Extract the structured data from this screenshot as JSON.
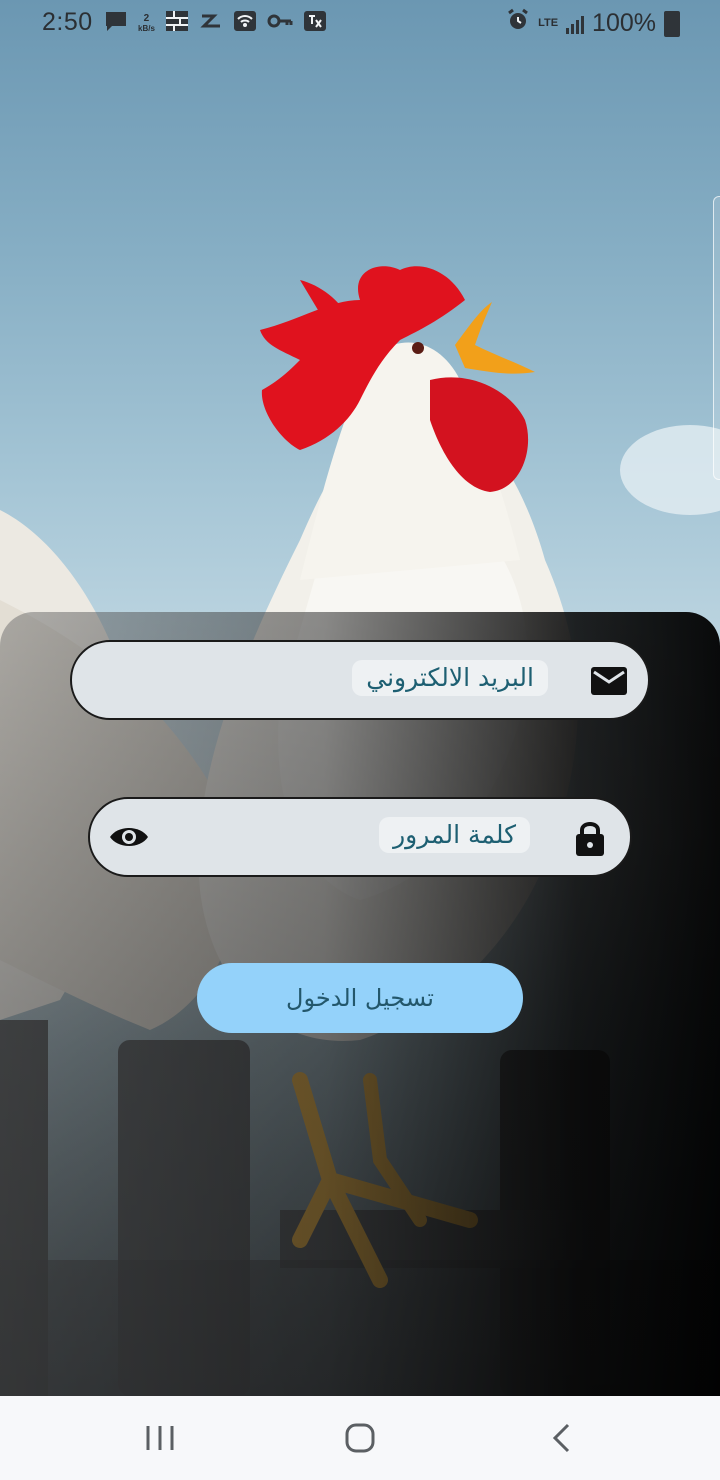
{
  "status_bar": {
    "time": "2:50",
    "speed_value": "2",
    "speed_unit": "kB/s",
    "network": "LTE",
    "battery_percent": "100%"
  },
  "login": {
    "email_placeholder": "البريد الالكتروني",
    "password_placeholder": "كلمة المرور",
    "submit_label": "تسجيل الدخول"
  },
  "icons": {
    "email": "mail-icon",
    "password": "lock-icon",
    "toggle_visibility": "eye-icon"
  },
  "colors": {
    "button_bg": "#94d2fa",
    "label_text": "#1d5f72",
    "field_bg": "#dfe4e8"
  }
}
